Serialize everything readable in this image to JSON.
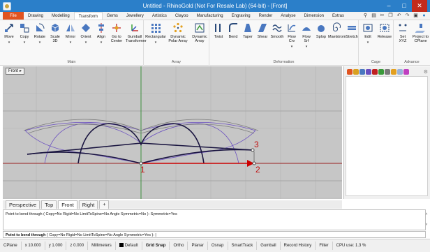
{
  "window": {
    "title": "Untitled - RhinoGold (Not For Resale Lab) (64-bit) - [Front]"
  },
  "ribbon_tabs": [
    "File",
    "Drawing",
    "Modelling",
    "Transform",
    "Gems",
    "Jewellery",
    "Artistics",
    "Clayoo",
    "Manufacturing",
    "Engraving",
    "Render",
    "Analyse",
    "Dimension",
    "Extras"
  ],
  "active_tab": "Transform",
  "ribbon": {
    "main": {
      "label": "Main",
      "buttons": [
        "Move",
        "Copy",
        "Rotate",
        "Scale\n3D",
        "Mirror",
        "Orient",
        "Align",
        "Go to\nCenter",
        "Gumball\nTransformer"
      ]
    },
    "array": {
      "label": "Array",
      "buttons": [
        "Rectangular",
        "Dynamic\nPolar Array",
        "Dynamic\nArray"
      ]
    },
    "deformation": {
      "label": "Deformation",
      "buttons": [
        "Twist",
        "Bend",
        "Taper",
        "Shear",
        "Smooth",
        "Flow\nCrv",
        "Flow\nSrf",
        "Splop",
        "Maelstrom",
        "Stretch"
      ]
    },
    "cage": {
      "label": "Cage",
      "buttons": [
        "Edit",
        "Release"
      ]
    },
    "advanced": {
      "label": "Advance",
      "buttons": [
        "Set\nXYZ",
        "Project to\nCPlane"
      ]
    }
  },
  "viewport": {
    "label": "Front",
    "points": [
      "1",
      "2",
      "3"
    ]
  },
  "viewport_tabs": [
    "Perspective",
    "Top",
    "Front",
    "Right",
    "+"
  ],
  "command": {
    "history": "Point to bend through ( Copy=No  Rigid=No  LimitToSpine=No  Angle  Symmetric=No ): Symmetric=Yes",
    "prompt_bold": "Point to bend through",
    "prompt_rest": " ( Copy=No  Rigid=No  LimitToSpine=No  Angle  Symmetric=Yes ):"
  },
  "status": {
    "cplane": "CPlane",
    "x": "x 10.000",
    "y": "y 1.000",
    "z": "z 0.000",
    "units": "Millimeters",
    "layer": "Default",
    "toggles": [
      "Grid Snap",
      "Ortho",
      "Planar",
      "Osnap",
      "SmartTrack",
      "Gumball",
      "Record History",
      "Filter"
    ],
    "cpu": "CPU use: 1.3 %"
  },
  "colors": {
    "title_bar": "#2b7fc9",
    "file_tab": "#e0531f",
    "viewport_bg": "#c6c6c6",
    "bend_arrow": "#cc0000"
  }
}
